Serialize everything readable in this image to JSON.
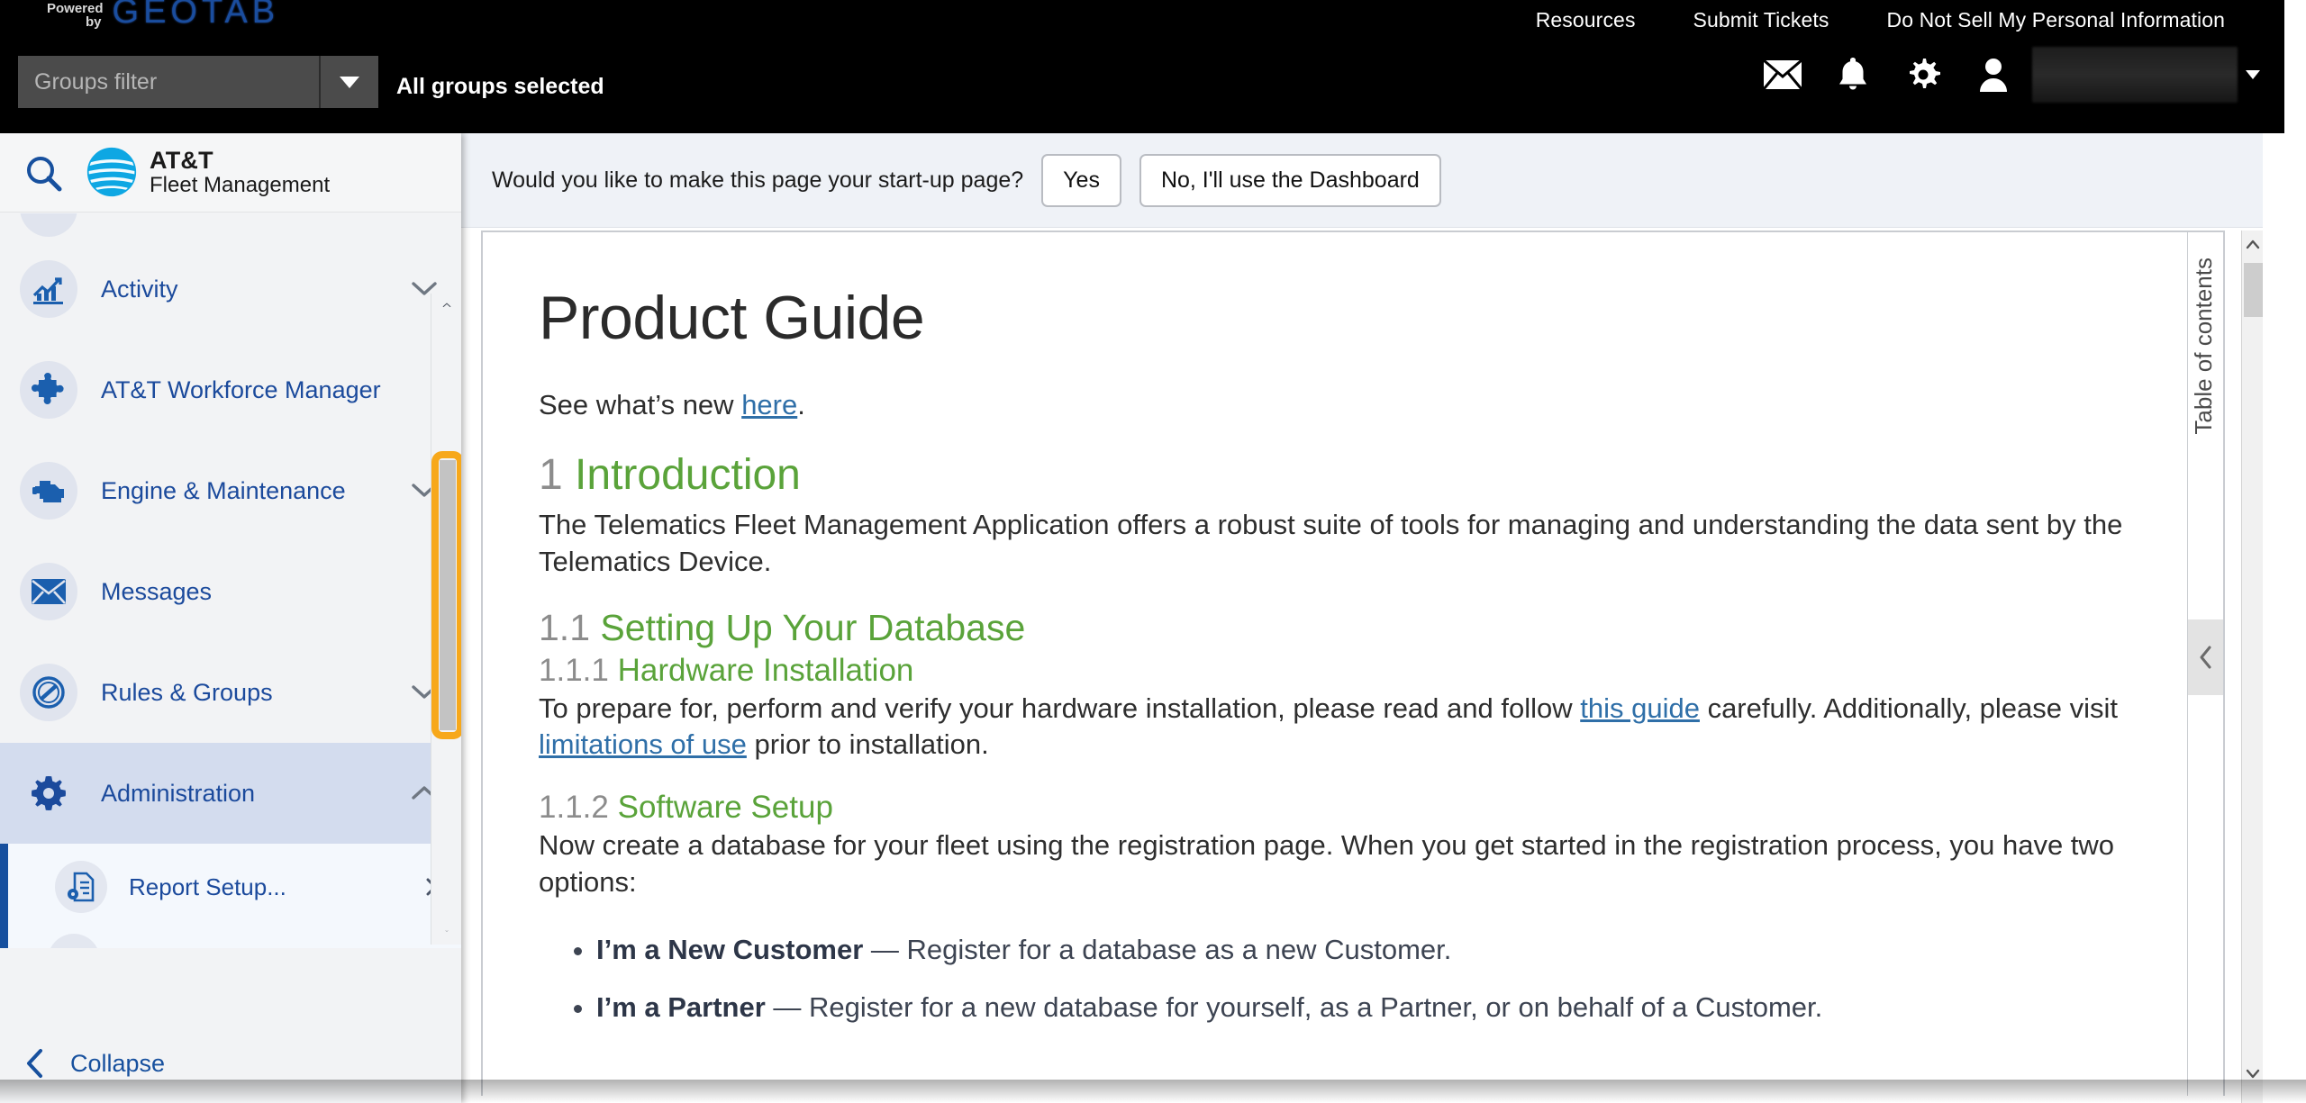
{
  "topbar": {
    "powered_by_line1": "Powered",
    "powered_by_line2": "by",
    "brand_word": "GEOTAB",
    "links": [
      {
        "label": "Resources"
      },
      {
        "label": "Submit Tickets"
      },
      {
        "label": "Do Not Sell My Personal Information"
      }
    ],
    "groups_filter_placeholder": "Groups filter",
    "groups_selected_label": "All groups selected",
    "icons": [
      {
        "name": "mail-icon"
      },
      {
        "name": "bell-icon"
      },
      {
        "name": "gear-icon"
      },
      {
        "name": "person-icon"
      }
    ],
    "user_name": ""
  },
  "sidebar": {
    "search_icon": "search-icon",
    "brand_line1": "AT&T",
    "brand_line2": "Fleet Management",
    "items": [
      {
        "label": "Activity",
        "icon": "chart-trend-icon",
        "expandable": true,
        "expanded": false
      },
      {
        "label": "AT&T Workforce Manager",
        "icon": "puzzle-piece-icon",
        "expandable": false,
        "expanded": false
      },
      {
        "label": "Engine & Maintenance",
        "icon": "engine-icon",
        "expandable": true,
        "expanded": false
      },
      {
        "label": "Messages",
        "icon": "envelope-icon",
        "expandable": false,
        "expanded": false
      },
      {
        "label": "Rules & Groups",
        "icon": "no-entry-icon",
        "expandable": true,
        "expanded": false
      },
      {
        "label": "Administration",
        "icon": "gear-icon",
        "expandable": true,
        "expanded": true
      }
    ],
    "sub_items": [
      {
        "label": "Report Setup...",
        "icon": "report-setup-icon",
        "has_submenu": true
      }
    ],
    "collapse_label": "Collapse",
    "focus_highlight_color": "#f7a81b"
  },
  "notice": {
    "text": "Would you like to make this page your start-up page?",
    "yes_label": "Yes",
    "no_label": "No, I'll use the Dashboard"
  },
  "document": {
    "title": "Product Guide",
    "intro_line_prefix": "See what’s new ",
    "intro_link": "here",
    "intro_line_suffix": ".",
    "sections": [
      {
        "number": "1",
        "heading": "Introduction",
        "body": "The Telematics Fleet Management Application offers a robust suite of tools for managing and understanding the data sent by the Telematics Device."
      },
      {
        "number": "1.1",
        "heading": "Setting Up Your Database"
      },
      {
        "number": "1.1.1",
        "heading": "Hardware Installation",
        "body_part1": "To prepare for, perform and verify your hardware installation, please read and follow ",
        "link1": "this guide",
        "body_part2": " carefully. Additionally, please visit ",
        "link2": "limitations of use",
        "body_part3": " prior to installation."
      },
      {
        "number": "1.1.2",
        "heading": "Software Setup",
        "body": "Now create a database for your fleet using the registration page. When you get started in the registration process, you have two options:"
      }
    ],
    "bullets": [
      {
        "bold": "I’m a New Customer",
        "rest": " — Register for a database as a new Customer."
      },
      {
        "bold": "I’m a Partner",
        "rest": " — Register for a new database for yourself, as a Partner, or on behalf of a Customer."
      }
    ],
    "toc_label": "Table of contents"
  },
  "colors": {
    "accent_blue": "#1b4a9c",
    "heading_green": "#5aa33a",
    "link_blue": "#2f6fa8",
    "focus_orange": "#f7a81b",
    "geotab_blue": "#1a4d9e"
  }
}
